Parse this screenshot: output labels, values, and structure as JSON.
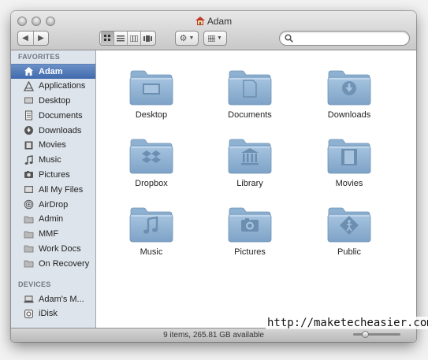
{
  "window": {
    "title": "Adam"
  },
  "toolbar": {
    "back_icon": "chevron-left-icon",
    "forward_icon": "chevron-right-icon",
    "views": [
      "icon-view",
      "list-view",
      "column-view",
      "coverflow-view"
    ],
    "active_view": "icon-view",
    "action_icon": "gear-icon",
    "arrange_icon": "grid-icon",
    "search": {
      "value": "",
      "placeholder": ""
    }
  },
  "sidebar": {
    "favorites_header": "FAVORITES",
    "favorites": [
      {
        "label": "Adam",
        "icon": "home-icon",
        "selected": true
      },
      {
        "label": "Applications",
        "icon": "applications-icon"
      },
      {
        "label": "Desktop",
        "icon": "desktop-icon"
      },
      {
        "label": "Documents",
        "icon": "documents-icon"
      },
      {
        "label": "Downloads",
        "icon": "downloads-icon"
      },
      {
        "label": "Movies",
        "icon": "movies-icon"
      },
      {
        "label": "Music",
        "icon": "music-icon"
      },
      {
        "label": "Pictures",
        "icon": "pictures-icon"
      },
      {
        "label": "All My Files",
        "icon": "all-files-icon"
      },
      {
        "label": "AirDrop",
        "icon": "airdrop-icon"
      },
      {
        "label": "Admin",
        "icon": "folder-icon"
      },
      {
        "label": "MMF",
        "icon": "folder-icon"
      },
      {
        "label": "Work Docs",
        "icon": "folder-icon"
      },
      {
        "label": "On Recovery",
        "icon": "folder-icon"
      }
    ],
    "devices_header": "DEVICES",
    "devices": [
      {
        "label": "Adam's M...",
        "icon": "laptop-icon"
      },
      {
        "label": "iDisk",
        "icon": "idisk-icon"
      }
    ]
  },
  "folders": [
    {
      "label": "Desktop",
      "icon": "desktop-folder-icon"
    },
    {
      "label": "Documents",
      "icon": "documents-folder-icon"
    },
    {
      "label": "Downloads",
      "icon": "downloads-folder-icon"
    },
    {
      "label": "Dropbox",
      "icon": "dropbox-folder-icon"
    },
    {
      "label": "Library",
      "icon": "library-folder-icon"
    },
    {
      "label": "Movies",
      "icon": "movies-folder-icon"
    },
    {
      "label": "Music",
      "icon": "music-folder-icon"
    },
    {
      "label": "Pictures",
      "icon": "pictures-folder-icon"
    },
    {
      "label": "Public",
      "icon": "public-folder-icon"
    }
  ],
  "status": {
    "text": "9 items, 265.81 GB available",
    "icon_size_fraction": 0.25
  },
  "watermark": "http://maketecheasier.com",
  "colors": {
    "selection": "#3f6aad",
    "folder": "#8fb3d3",
    "sidebar_bg": "#dde4eb"
  }
}
